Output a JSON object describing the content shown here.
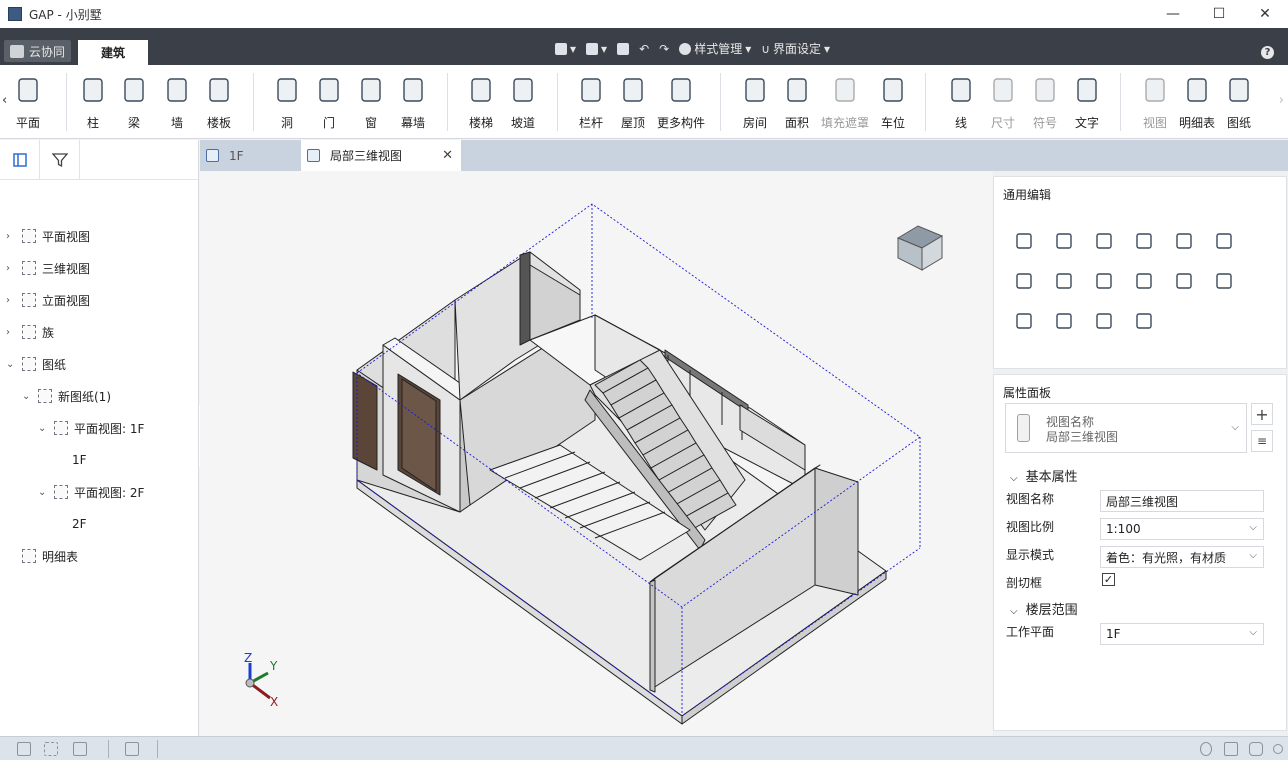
{
  "window": {
    "title": "GAP - 小别墅"
  },
  "tabs": {
    "cloud": "云协同",
    "active": "建筑"
  },
  "quick": {
    "style": "样式管理",
    "ui": "界面设定"
  },
  "ribbon": {
    "tools": [
      "平面",
      "柱",
      "梁",
      "墙",
      "楼板",
      "洞",
      "门",
      "窗",
      "幕墙",
      "楼梯",
      "坡道",
      "栏杆",
      "屋顶",
      "更多构件",
      "房间",
      "面积",
      "填充遮罩",
      "车位",
      "线",
      "尺寸",
      "符号",
      "文字",
      "视图",
      "明细表",
      "图纸"
    ]
  },
  "tree": {
    "items": [
      "平面视图",
      "三维视图",
      "立面视图",
      "族",
      "图纸",
      "新图纸(1)",
      "平面视图: 1F",
      "1F",
      "平面视图: 2F",
      "2F",
      "明细表"
    ]
  },
  "doctabs": {
    "tab1": "1F",
    "tab2": "局部三维视图"
  },
  "axes": {
    "z": "Z",
    "y": "Y",
    "x": "X"
  },
  "edit": {
    "title": "通用编辑"
  },
  "props": {
    "title": "属性面板",
    "type_label": "视图名称",
    "type_value": "局部三维视图",
    "basic": "基本属性",
    "name_label": "视图名称",
    "name_value": "局部三维视图",
    "scale_label": "视图比例",
    "scale_value": "1:100",
    "display_label": "显示模式",
    "display_value": "着色：有光照，有材质",
    "section_label": "剖切框",
    "section_checked": true,
    "floor": "楼层范围",
    "workplane_label": "工作平面",
    "workplane_value": "1F"
  },
  "colors": {
    "accent": "#3b4048",
    "selection": "#0000cc",
    "door": "#5a4538"
  }
}
